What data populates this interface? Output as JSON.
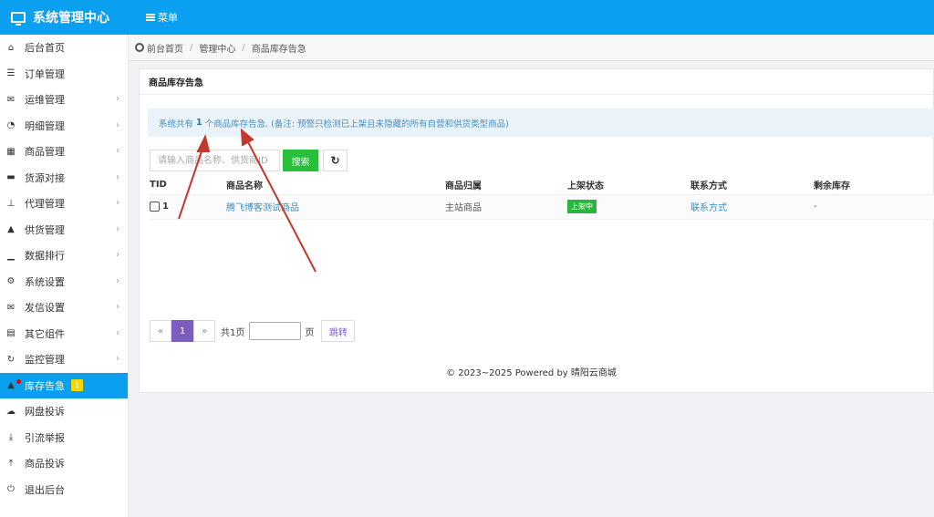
{
  "app": {
    "title": "系统管理中心",
    "menu_label": "菜单"
  },
  "sidebar": {
    "items": [
      {
        "label": "后台首页",
        "icon": "home-icon",
        "glyph": "⌂",
        "chevron": false
      },
      {
        "label": "订单管理",
        "icon": "list-icon",
        "glyph": "☰",
        "chevron": false
      },
      {
        "label": "运维管理",
        "icon": "comments-icon",
        "glyph": "✉",
        "chevron": true
      },
      {
        "label": "明细管理",
        "icon": "pie-chart-icon",
        "glyph": "◔",
        "chevron": true
      },
      {
        "label": "商品管理",
        "icon": "grid-icon",
        "glyph": "▦",
        "chevron": true
      },
      {
        "label": "货源对接",
        "icon": "briefcase-icon",
        "glyph": "▬",
        "chevron": true
      },
      {
        "label": "代理管理",
        "icon": "sitemap-icon",
        "glyph": "⊥",
        "chevron": true
      },
      {
        "label": "供货管理",
        "icon": "shopping-bag-icon",
        "glyph": "▲",
        "chevron": true
      },
      {
        "label": "数据排行",
        "icon": "signal-icon",
        "glyph": "▁",
        "chevron": true
      },
      {
        "label": "系统设置",
        "icon": "gears-icon",
        "glyph": "⚙",
        "chevron": true
      },
      {
        "label": "发信设置",
        "icon": "envelope-icon",
        "glyph": "✉",
        "chevron": true
      },
      {
        "label": "其它组件",
        "icon": "calendar-icon",
        "glyph": "▤",
        "chevron": true
      },
      {
        "label": "监控管理",
        "icon": "refresh-icon",
        "glyph": "↻",
        "chevron": true
      },
      {
        "label": "库存告急",
        "icon": "bell-icon",
        "glyph": "▲",
        "chevron": false,
        "active": true,
        "badge": "1"
      },
      {
        "label": "网盘投诉",
        "icon": "cloud-upload-icon",
        "glyph": "☁",
        "chevron": false
      },
      {
        "label": "引流举报",
        "icon": "download-icon",
        "glyph": "⤓",
        "chevron": false
      },
      {
        "label": "商品投诉",
        "icon": "upload-icon",
        "glyph": "⤒",
        "chevron": false
      },
      {
        "label": "退出后台",
        "icon": "power-icon",
        "glyph": "⏻",
        "chevron": false
      }
    ]
  },
  "breadcrumb": {
    "home": "前台首页",
    "middle": "管理中心",
    "current": "商品库存告急"
  },
  "panel": {
    "title": "商品库存告急",
    "alert_prefix": "系统共有",
    "alert_count": "1",
    "alert_suffix": "个商品库存告急. (备注: 预警只检测已上架且未隐藏的所有自营和供货类型商品)"
  },
  "toolbar": {
    "search_placeholder": "请输入商品名称、供货商ID",
    "search_label": "搜索",
    "refresh_glyph": "↻"
  },
  "table": {
    "headers": [
      "TID",
      "商品名称",
      "商品归属",
      "上架状态",
      "联系方式",
      "剩余库存"
    ],
    "rows": [
      {
        "tid": "1",
        "name": "腾飞博客测试商品",
        "owner": "主站商品",
        "status": "上架中",
        "contact": "联系方式",
        "stock": "-"
      }
    ]
  },
  "pager": {
    "prev": "«",
    "current": "1",
    "next": "»",
    "total": "共1页",
    "unit": "页",
    "jump": "跳转"
  },
  "footer": {
    "text": "© 2023~2025 Powered by 晴阳云商城"
  },
  "colors": {
    "primary": "#0aa0ef",
    "success": "#28c03a",
    "accent": "#7c5cbf",
    "badge": "#f5d800",
    "annotation": "#c0392b"
  }
}
